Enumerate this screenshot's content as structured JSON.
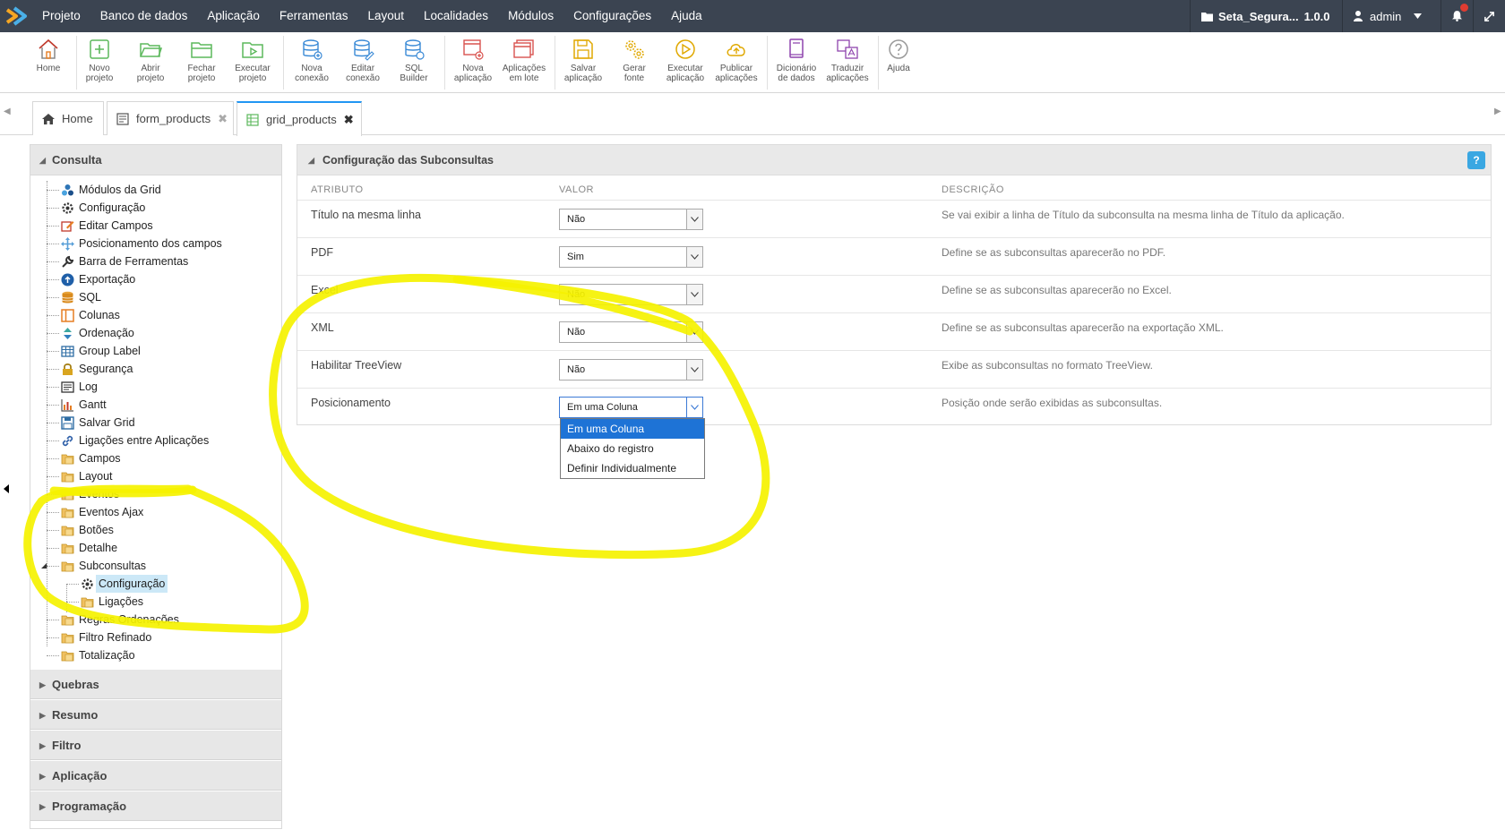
{
  "menubar": {
    "items": [
      "Projeto",
      "Banco de dados",
      "Aplicação",
      "Ferramentas",
      "Layout",
      "Localidades",
      "Módulos",
      "Configurações",
      "Ajuda"
    ],
    "project_name": "Seta_Segura...",
    "version": "1.0.0",
    "user": "admin"
  },
  "toolbar": {
    "buttons": [
      {
        "label1": "Home",
        "label2": ""
      },
      {
        "label1": "Novo",
        "label2": "projeto"
      },
      {
        "label1": "Abrir",
        "label2": "projeto"
      },
      {
        "label1": "Fechar",
        "label2": "projeto"
      },
      {
        "label1": "Executar",
        "label2": "projeto"
      },
      {
        "label1": "Nova",
        "label2": "conexão"
      },
      {
        "label1": "Editar",
        "label2": "conexão"
      },
      {
        "label1": "SQL",
        "label2": "Builder"
      },
      {
        "label1": "Nova",
        "label2": "aplicação"
      },
      {
        "label1": "Aplicações",
        "label2": "em lote"
      },
      {
        "label1": "Salvar",
        "label2": "aplicação"
      },
      {
        "label1": "Gerar",
        "label2": "fonte"
      },
      {
        "label1": "Executar",
        "label2": "aplicação"
      },
      {
        "label1": "Publicar",
        "label2": "aplicações"
      },
      {
        "label1": "Dicionário",
        "label2": "de dados"
      },
      {
        "label1": "Traduzir",
        "label2": "aplicações"
      },
      {
        "label1": "Ajuda",
        "label2": ""
      }
    ]
  },
  "tabs": [
    {
      "label": "Home"
    },
    {
      "label": "form_products"
    },
    {
      "label": "grid_products"
    }
  ],
  "sidebar": {
    "section_title": "Consulta",
    "tree": [
      "Módulos da Grid",
      "Configuração",
      "Editar Campos",
      "Posicionamento dos campos",
      "Barra de Ferramentas",
      "Exportação",
      "SQL",
      "Colunas",
      "Ordenação",
      "Group Label",
      "Segurança",
      "Log",
      "Gantt",
      "Salvar Grid",
      "Ligações entre Aplicações",
      "Campos",
      "Layout",
      "Eventos",
      "Eventos Ajax",
      "Botões",
      "Detalhe",
      "Subconsultas",
      "Configuração",
      "Ligações",
      "Regras Ordenações",
      "Filtro Refinado",
      "Totalização"
    ],
    "closed_sections": [
      "Quebras",
      "Resumo",
      "Filtro",
      "Aplicação",
      "Programação"
    ]
  },
  "panel": {
    "title": "Configuração das Subconsultas",
    "col_attr": "ATRIBUTO",
    "col_value": "VALOR",
    "col_desc": "DESCRIÇÃO",
    "rows": [
      {
        "attr": "Título na mesma linha",
        "value": "Não",
        "desc": "Se vai exibir a linha de Título da subconsulta na mesma linha de Título da aplicação."
      },
      {
        "attr": "PDF",
        "value": "Sim",
        "desc": "Define se as subconsultas aparecerão no PDF."
      },
      {
        "attr": "Excel",
        "value": "Não",
        "desc": "Define se as subconsultas aparecerão no Excel."
      },
      {
        "attr": "XML",
        "value": "Não",
        "desc": "Define se as subconsultas aparecerão na exportação XML."
      },
      {
        "attr": "Habilitar TreeView",
        "value": "Não",
        "desc": "Exibe as subconsultas no formato TreeView."
      },
      {
        "attr": "Posicionamento",
        "value": "Em uma Coluna",
        "desc": "Posição onde serão exibidas as subconsultas."
      }
    ],
    "dropdown_options": [
      "Em uma Coluna",
      "Abaixo do registro",
      "Definir Individualmente"
    ]
  },
  "colors": {
    "menubar_bg": "#3b4451",
    "accent": "#2196f3",
    "highlight": "#1e73d6",
    "annotation": "#f5f200"
  }
}
